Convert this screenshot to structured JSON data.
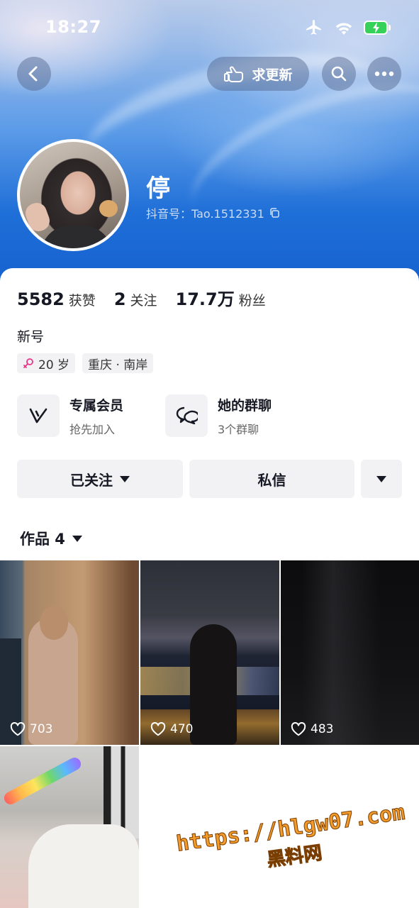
{
  "status_bar": {
    "time": "18:27",
    "icons": [
      "airplane-icon",
      "wifi-icon",
      "battery-charging-icon"
    ]
  },
  "nav": {
    "back_icon": "chevron-left-icon",
    "update_button": {
      "icon": "pointing-hand-icon",
      "label": "求更新"
    },
    "search_icon": "search-icon",
    "more_icon": "more-dots-icon"
  },
  "profile": {
    "nickname": "停",
    "douyin_id": "抖音号：Tao.1512331",
    "copy_icon": "copy-icon"
  },
  "stats": [
    {
      "value": "5582",
      "label": "获赞"
    },
    {
      "value": "2",
      "label": "关注"
    },
    {
      "value": "17.7万",
      "label": "粉丝"
    }
  ],
  "bio": "新号",
  "tags": [
    {
      "icon": "female-icon",
      "label": "20 岁"
    },
    {
      "label": "重庆 · 南岸"
    }
  ],
  "features": {
    "member": {
      "icon": "vip-v-icon",
      "title": "专属会员",
      "subtitle": "抢先加入"
    },
    "group": {
      "icon": "group-chat-icon",
      "title": "她的群聊",
      "subtitle": "3个群聊"
    }
  },
  "actions": {
    "follow": "已关注",
    "message": "私信",
    "more_icon": "triangle-down-icon"
  },
  "works_tab": {
    "label": "作品 4"
  },
  "works": [
    {
      "likes": "703"
    },
    {
      "likes": "470"
    },
    {
      "likes": "483"
    },
    {
      "likes": ""
    }
  ],
  "watermark": {
    "url": "https://hlgw07.com",
    "brand": "黑料网"
  },
  "colors": {
    "accent_blue": "#1661cf",
    "button_bg": "#f2f2f4",
    "female_pink": "#e8388a",
    "watermark_orange": "#f29b2a"
  }
}
